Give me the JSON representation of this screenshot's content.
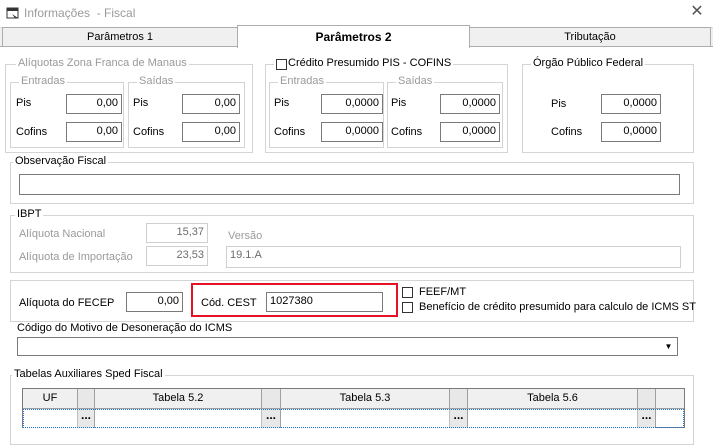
{
  "window": {
    "title": "Informações  - Fiscal",
    "close_glyph": "✕"
  },
  "tabs": [
    {
      "label": "Parâmetros 1",
      "active": false
    },
    {
      "label": "Parâmetros 2",
      "active": true
    },
    {
      "label": "Tributação",
      "active": false
    }
  ],
  "zona_franca": {
    "legend": "Alíquotas Zona Franca de Manaus",
    "entradas": {
      "legend": "Entradas",
      "pis_label": "Pis",
      "pis_value": "0,00",
      "cofins_label": "Cofins",
      "cofins_value": "0,00"
    },
    "saidas": {
      "legend": "Saídas",
      "pis_label": "Pis",
      "pis_value": "0,00",
      "cofins_label": "Cofins",
      "cofins_value": "0,00"
    }
  },
  "credito_presumido": {
    "legend": "Crédito Presumido PIS - COFINS",
    "checked": false,
    "entradas": {
      "legend": "Entradas",
      "pis_label": "Pis",
      "pis_value": "0,0000",
      "cofins_label": "Cofins",
      "cofins_value": "0,0000"
    },
    "saidas": {
      "legend": "Saídas",
      "pis_label": "Pis",
      "pis_value": "0,0000",
      "cofins_label": "Cofins",
      "cofins_value": "0,0000"
    }
  },
  "orgao_publico": {
    "legend": "Órgão Público Federal",
    "pis_label": "Pis",
    "pis_value": "0,0000",
    "cofins_label": "Cofins",
    "cofins_value": "0,0000"
  },
  "observacao": {
    "legend": "Observação Fiscal",
    "value": ""
  },
  "ibpt": {
    "legend": "IBPT",
    "nacional_label": "Alíquota Nacional",
    "nacional_value": "15,37",
    "importacao_label": "Alíquota de Importação",
    "importacao_value": "23,53",
    "versao_label": "Versão",
    "versao_value": "19.1.A"
  },
  "fecep": {
    "label": "Alíquota do FECEP",
    "value": "0,00"
  },
  "cest": {
    "label": "Cód. CEST",
    "value": "1027380"
  },
  "feef": {
    "label": "FEEF/MT",
    "checked": false
  },
  "beneficio": {
    "label": "Benefício de crédito presumido para calculo de ICMS ST",
    "checked": false
  },
  "desoneracao": {
    "label": "Código do Motivo de Desoneração do ICMS",
    "value": ""
  },
  "sped": {
    "legend": "Tabelas Auxiliares Sped Fiscal",
    "columns": [
      "UF",
      "Tabela 5.2",
      "Tabela 5.3",
      "Tabela 5.6"
    ],
    "button_label": "..."
  },
  "colors": {
    "highlight": "#e81123",
    "disabled_text": "#9a9a9a"
  }
}
